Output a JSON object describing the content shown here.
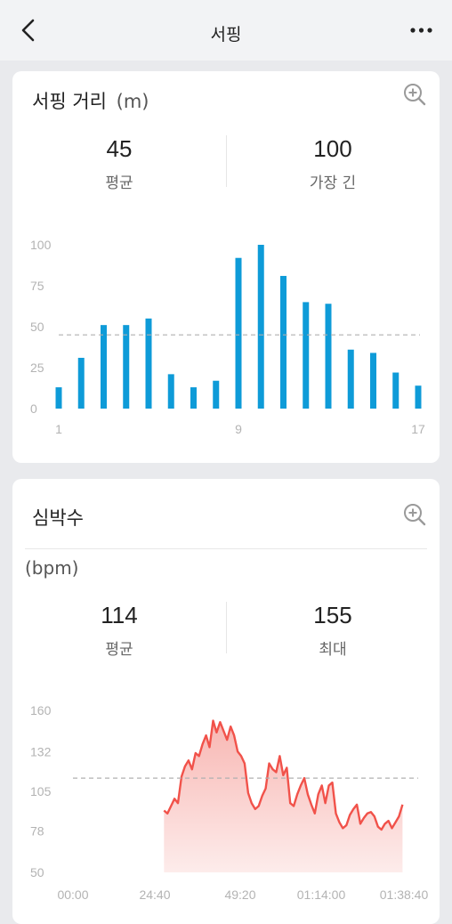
{
  "header": {
    "title": "서핑"
  },
  "surf_distance": {
    "title": "서핑 거리",
    "unit": "(m)",
    "stats": [
      {
        "value": "45",
        "label": "평균"
      },
      {
        "value": "100",
        "label": "가장 긴"
      }
    ]
  },
  "heart_rate": {
    "title": "심박수",
    "unit": "(bpm)",
    "stats": [
      {
        "value": "114",
        "label": "평균"
      },
      {
        "value": "155",
        "label": "최대"
      }
    ]
  },
  "colors": {
    "bar": "#0e9bd8",
    "hr_line": "#f1524a",
    "hr_fill_top": "#f8b7b3",
    "hr_fill_bottom": "#fdeceb",
    "avg_line": "#b0b0b0"
  },
  "chart_data": [
    {
      "type": "bar",
      "categories": [
        "1",
        "2",
        "3",
        "4",
        "5",
        "6",
        "7",
        "8",
        "9",
        "10",
        "11",
        "12",
        "13",
        "14",
        "15",
        "16",
        "17"
      ],
      "values": [
        13,
        31,
        51,
        51,
        55,
        21,
        13,
        17,
        92,
        100,
        81,
        65,
        64,
        36,
        34,
        22,
        14
      ],
      "average": 45,
      "ylim": [
        0,
        100
      ],
      "yticks": [
        "0",
        "25",
        "50",
        "75",
        "100"
      ],
      "xticks": [
        "1",
        "9",
        "17"
      ],
      "grid": false
    },
    {
      "type": "area",
      "ylim": [
        50,
        160
      ],
      "yticks": [
        "50",
        "78",
        "105",
        "132",
        "160"
      ],
      "xticks": [
        "00:00",
        "24:40",
        "49:20",
        "01:14:00",
        "01:38:40"
      ],
      "xlim_minutes": [
        0,
        98.67
      ],
      "average": 114,
      "x": [
        30,
        31,
        32,
        33,
        34,
        35,
        36,
        37,
        38,
        39,
        40,
        41,
        42,
        43,
        44,
        45,
        46,
        47,
        48,
        49,
        50,
        51,
        52,
        53,
        54,
        55,
        56,
        57,
        58,
        59,
        60,
        61,
        62,
        63,
        64,
        65,
        66,
        67,
        68,
        69,
        70,
        71,
        72,
        73,
        74,
        75,
        76,
        77,
        78,
        79,
        80,
        81,
        82,
        83,
        84,
        85,
        86,
        87,
        88,
        89,
        90,
        91,
        92,
        93,
        94,
        95,
        96,
        97,
        98
      ],
      "y": [
        92,
        90,
        95,
        100,
        97,
        115,
        122,
        126,
        120,
        131,
        129,
        137,
        143,
        135,
        153,
        145,
        152,
        146,
        140,
        149,
        143,
        132,
        129,
        124,
        104,
        97,
        93,
        95,
        102,
        107,
        124,
        120,
        118,
        129,
        116,
        121,
        97,
        95,
        103,
        109,
        114,
        103,
        96,
        90,
        103,
        109,
        97,
        109,
        111,
        90,
        84,
        80,
        82,
        89,
        93,
        96,
        83,
        87,
        90,
        91,
        88,
        81,
        79,
        83,
        85,
        80,
        84,
        88,
        96
      ]
    }
  ]
}
